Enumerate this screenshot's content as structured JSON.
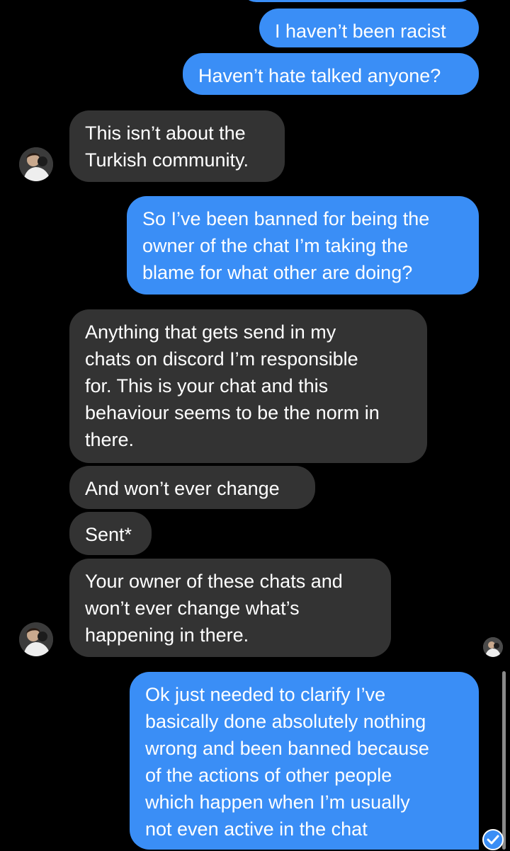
{
  "conversation": {
    "messages": [
      {
        "id": "m1",
        "direction": "sent",
        "text": "I haven’t been racist"
      },
      {
        "id": "m2",
        "direction": "sent",
        "text": "Haven’t hate talked anyone?"
      },
      {
        "id": "m3",
        "direction": "received",
        "text": "This isn’t about the\nTurkish community."
      },
      {
        "id": "m4",
        "direction": "sent",
        "text": "So I’ve been banned for being the\nowner of the chat I’m taking the\nblame for what other are doing?"
      },
      {
        "id": "m5",
        "direction": "received",
        "text": "Anything that gets send in my\nchats on discord I’m responsible\nfor. This is your chat and this\nbehaviour seems to be the norm in\nthere."
      },
      {
        "id": "m6",
        "direction": "received",
        "text": "And won’t ever change"
      },
      {
        "id": "m7",
        "direction": "received",
        "text": "Sent*"
      },
      {
        "id": "m8",
        "direction": "received",
        "text": "Your owner of these chats and\nwon’t ever change what’s\nhappening in there."
      },
      {
        "id": "m9",
        "direction": "sent",
        "text": "Ok just needed to clarify I’ve\nbasically done absolutely nothing\nwrong and been banned because\nof the actions of other people\nwhich happen when I’m usually\nnot even active in the chat"
      }
    ]
  },
  "colors": {
    "background": "#000000",
    "sent_bubble": "#3a8ef6",
    "received_bubble": "#333333",
    "text": "#ffffff"
  },
  "icons": {
    "avatar": "contact-avatar-icon",
    "seen": "seen-avatar-icon",
    "read": "read-check-icon"
  }
}
